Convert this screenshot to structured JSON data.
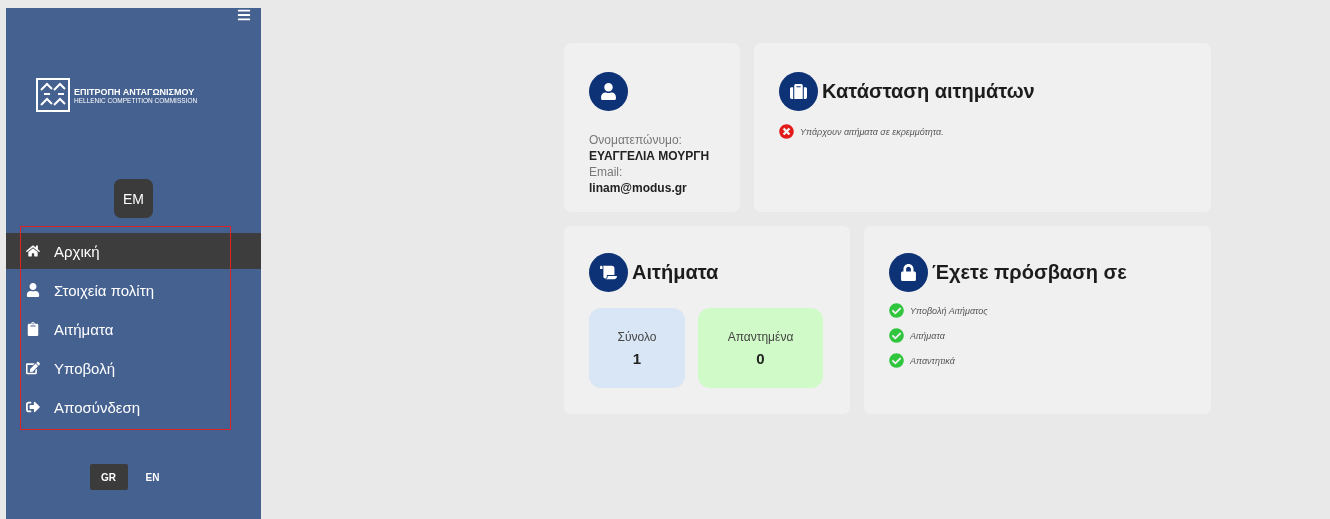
{
  "sidebar": {
    "logo": {
      "title": "ΕΠΙΤΡΟΠΗ ΑΝΤΑΓΩΝΙΣΜΟΥ",
      "subtitle": "HELLENIC COMPETITION COMMISSION"
    },
    "avatar": "EM",
    "nav": [
      {
        "label": "Αρχική",
        "selected": true
      },
      {
        "label": "Στοιχεία πολίτη",
        "selected": false
      },
      {
        "label": "Αιτήματα",
        "selected": false
      },
      {
        "label": "Υποβολή",
        "selected": false
      },
      {
        "label": "Αποσύνδεση",
        "selected": false
      }
    ],
    "languages": [
      {
        "label": "GR",
        "selected": true
      },
      {
        "label": "EN",
        "selected": false
      }
    ]
  },
  "profile": {
    "name_label": "Ονοματεπώνυμο:",
    "name": "ΕΥΑΓΓΕΛΙΑ ΜΟΥΡΓΗ",
    "email_label": "Email:",
    "email": "linam@modus.gr"
  },
  "status": {
    "title": "Κατάσταση αιτημάτων",
    "message": "Υπάρχουν αιτήματα σε εκρεμμότητα."
  },
  "requests": {
    "title": "Αιτήματα",
    "stats": [
      {
        "label": "Σύνολο",
        "value": "1",
        "color": "#d9e6f5"
      },
      {
        "label": "Απαντημένα",
        "value": "0",
        "color": "#d0fbc8"
      }
    ]
  },
  "access": {
    "title": "Έχετε πρόσβαση σε",
    "items": [
      "Υποβολή Αιτήματος",
      "Αιτήματα",
      "Απαντητικά"
    ]
  }
}
